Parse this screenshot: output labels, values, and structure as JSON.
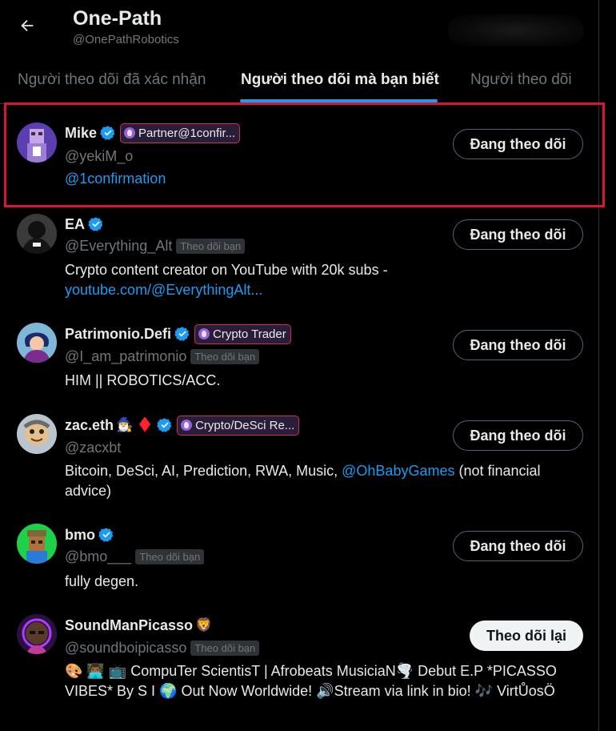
{
  "header": {
    "title": "One-Path",
    "handle": "@OnePathRobotics"
  },
  "tabs": [
    {
      "label": "Người theo dõi đã xác nhận",
      "active": false
    },
    {
      "label": "Người theo dõi mà bạn biết",
      "active": true
    },
    {
      "label": "Người theo dõi",
      "active": false
    }
  ],
  "users": [
    {
      "name": "Mike",
      "badge": "Partner@1confir...",
      "handle": "@yekiM_o",
      "follows_you": "",
      "bio_link": "@1confirmation",
      "button": "Đang theo dõi"
    },
    {
      "name": "EA",
      "badge": "",
      "handle": "@Everything_Alt",
      "follows_you": "Theo dõi bạn",
      "bio": "Crypto content creator on YouTube with 20k subs -",
      "bio_link": "youtube.com/@EverythingAlt...",
      "button": "Đang theo dõi"
    },
    {
      "name": "Patrimonio.Defi",
      "badge": "Crypto Trader",
      "handle": "@I_am_patrimonio",
      "follows_you": "Theo dõi bạn",
      "bio": "HIM || ROBOTICS/ACC.",
      "button": "Đang theo dõi"
    },
    {
      "name": "zac.eth",
      "name_emoji": "🧙‍♂️ ♦️",
      "badge": "Crypto/DeSci Re...",
      "handle": "@zacxbt",
      "follows_you": "",
      "bio_pre": "Bitcoin, DeSci, AI, Prediction, RWA, Music,",
      "bio_link": "@OhBabyGames",
      "bio_post": "(not financial advice)",
      "button": "Đang theo dõi"
    },
    {
      "name": "bmo",
      "badge": "",
      "handle": "@bmo___",
      "follows_you": "Theo dõi bạn",
      "bio": "fully degen.",
      "button": "Đang theo dõi"
    },
    {
      "name": "SoundManPicasso",
      "name_emoji": "🦁",
      "badge": "",
      "handle": "@soundboipicasso",
      "follows_you": "Theo dõi bạn",
      "bio": "🎨 👨🏾‍💻 📺 CompuTer ScientisT | Afrobeats MusiciaN🌪️ Debut E.P *PICASSO VIBES* By S I 🌍 Out Now Worldwide! 🔊Stream via link in bio! 🎶 VirtŮosÖ",
      "button": "Theo dõi lại"
    }
  ],
  "colors": {
    "accent": "#1d9bf0",
    "highlight": "#e0123a",
    "badge_border": "#c9314f"
  }
}
